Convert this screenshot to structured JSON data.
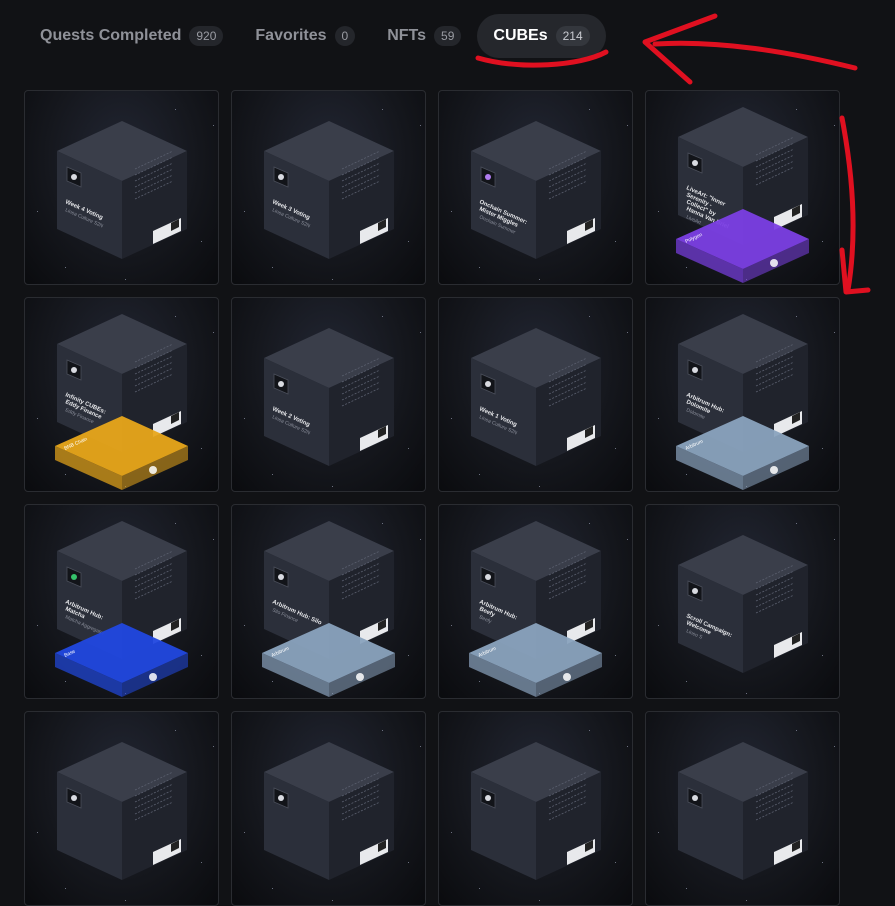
{
  "tabs": [
    {
      "label": "Quests Completed",
      "count": "920",
      "active": false
    },
    {
      "label": "Favorites",
      "count": "0",
      "active": false
    },
    {
      "label": "NFTs",
      "count": "59",
      "active": false
    },
    {
      "label": "CUBEs",
      "count": "214",
      "active": true
    }
  ],
  "cubes": [
    {
      "title": [
        "Week 4 Voting"
      ],
      "subtitle": "Linea Culture S2N",
      "icon": "linea-logo-icon",
      "base": null
    },
    {
      "title": [
        "Week 3 Voting"
      ],
      "subtitle": "Linea Culture S2N",
      "icon": "linea-logo-icon",
      "base": null
    },
    {
      "title": [
        "Onchain Summer:",
        "Mister Miggles"
      ],
      "subtitle": "Onchain Summer",
      "icon": "purple-app-icon",
      "base": null
    },
    {
      "title": [
        "LiveArt: \"Inner",
        "Serenity -",
        "Collect\" by",
        "Hanna Van Briel"
      ],
      "subtitle": "LiveArt",
      "icon": "liveart-logo-icon",
      "base": {
        "label": "Polygon",
        "color": "#7b3fe4"
      }
    },
    {
      "title": [
        "Infinity CUBEs:",
        "Eddy Finance"
      ],
      "subtitle": "Eddy Finance",
      "icon": "eddy-logo-icon",
      "base": {
        "label": "BNB Chain",
        "color": "#e8a61a"
      }
    },
    {
      "title": [
        "Week 2 Voting"
      ],
      "subtitle": "Linea Culture S2N",
      "icon": "linea-logo-icon",
      "base": null
    },
    {
      "title": [
        "Week 1 Voting"
      ],
      "subtitle": "Linea Culture S2N",
      "icon": "linea-logo-icon",
      "base": null
    },
    {
      "title": [
        "Arbitrum Hub:",
        "Dolomite"
      ],
      "subtitle": "Dolomite",
      "icon": "dolomite-logo-icon",
      "base": {
        "label": "Arbitrum",
        "color": "#8aa3be"
      }
    },
    {
      "title": [
        "Arbitrum Hub:",
        "Matcha"
      ],
      "subtitle": "Matcha Aggregator",
      "icon": "matcha-logo-icon",
      "base": {
        "label": "Base",
        "color": "#2148e0"
      }
    },
    {
      "title": [
        "Arbitrum Hub: Silo"
      ],
      "subtitle": "Silo Finance",
      "icon": "silo-logo-icon",
      "base": {
        "label": "Arbitrum",
        "color": "#8aa3be"
      }
    },
    {
      "title": [
        "Arbitrum Hub:",
        "Beefy"
      ],
      "subtitle": "Beefy",
      "icon": "beefy-logo-icon",
      "base": {
        "label": "Arbitrum",
        "color": "#8aa3be"
      }
    },
    {
      "title": [
        "Scroll Campaign:",
        "Welcome"
      ],
      "subtitle": "Lineo S",
      "icon": "scroll-logo-icon",
      "base": null
    },
    {
      "title": [],
      "subtitle": "",
      "icon": "app-logo-icon",
      "base": null
    },
    {
      "title": [],
      "subtitle": "",
      "icon": "app-logo-icon",
      "base": null
    },
    {
      "title": [],
      "subtitle": "",
      "icon": "app-logo-icon",
      "base": null
    },
    {
      "title": [],
      "subtitle": "",
      "icon": "app-logo-icon",
      "base": null
    }
  ],
  "annotation_color": "#e01020"
}
